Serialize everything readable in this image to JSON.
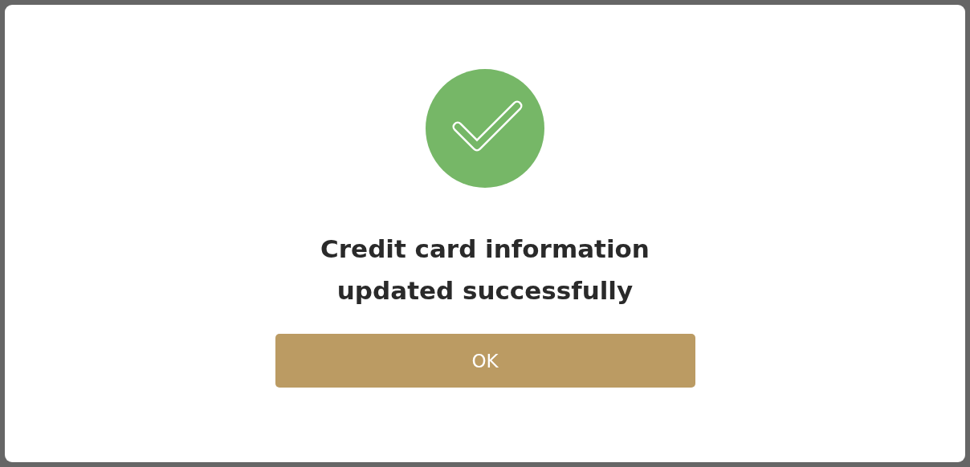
{
  "dialog": {
    "message": "Credit card information updated successfully",
    "buttons": [
      "OK"
    ]
  }
}
